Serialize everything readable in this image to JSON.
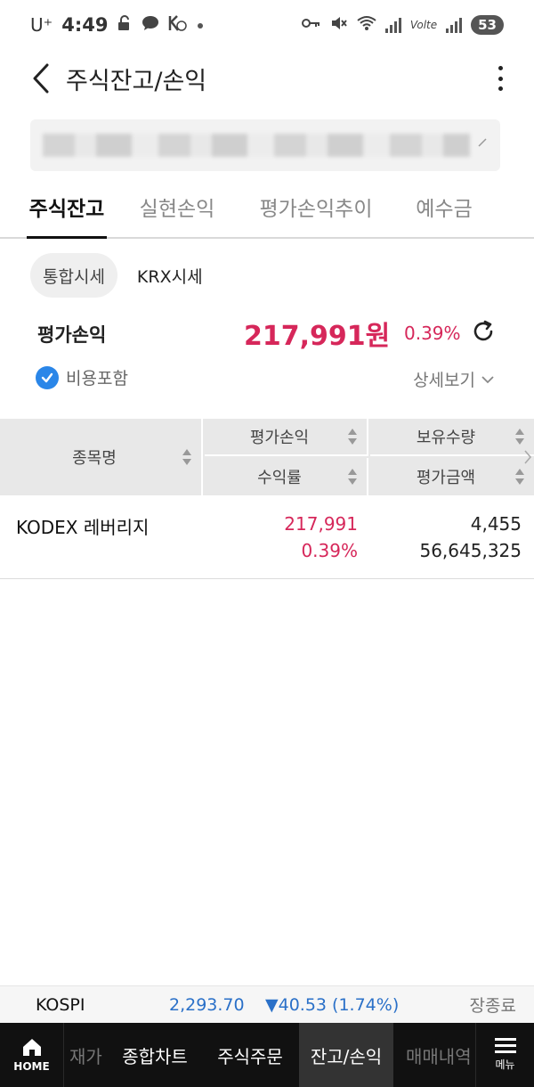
{
  "status_bar": {
    "carrier": "U⁺",
    "time": "4:49",
    "volte": "Volte",
    "battery": "53"
  },
  "app_bar": {
    "title": "주식잔고/손익"
  },
  "tabs": [
    {
      "label": "주식잔고",
      "active": true
    },
    {
      "label": "실현손익",
      "active": false
    },
    {
      "label": "평가손익추이",
      "active": false
    },
    {
      "label": "예수금",
      "active": false
    }
  ],
  "price_source": {
    "options": [
      "통합시세",
      "KRX시세"
    ],
    "selected": "통합시세"
  },
  "summary": {
    "label": "평가손익",
    "amount": "217,991원",
    "rate": "0.39%",
    "fee_included_label": "비용포함",
    "fee_included": true,
    "detail_label": "상세보기"
  },
  "table": {
    "headers": {
      "name": "종목명",
      "eval_pl": "평가손익",
      "return_rate": "수익률",
      "quantity": "보유수량",
      "eval_amount": "평가금액"
    },
    "rows": [
      {
        "name": "KODEX 레버리지",
        "eval_pl": "217,991",
        "return_rate": "0.39%",
        "quantity": "4,455",
        "eval_amount": "56,645,325"
      }
    ]
  },
  "ticker": {
    "index": "KOSPI",
    "value": "2,293.70",
    "change": "▼40.53 (1.74%)",
    "status": "장종료"
  },
  "bottom_nav": {
    "home_label": "HOME",
    "items": [
      {
        "label": "재가",
        "state": "faded"
      },
      {
        "label": "종합차트",
        "state": "normal"
      },
      {
        "label": "주식주문",
        "state": "normal"
      },
      {
        "label": "잔고/손익",
        "state": "active"
      },
      {
        "label": "매매내역",
        "state": "faded"
      }
    ],
    "menu_label": "메뉴"
  },
  "colors": {
    "profit": "#d6275a",
    "index_down": "#2a70c8",
    "check_blue": "#2a86e8",
    "nav_bg": "#111111"
  }
}
